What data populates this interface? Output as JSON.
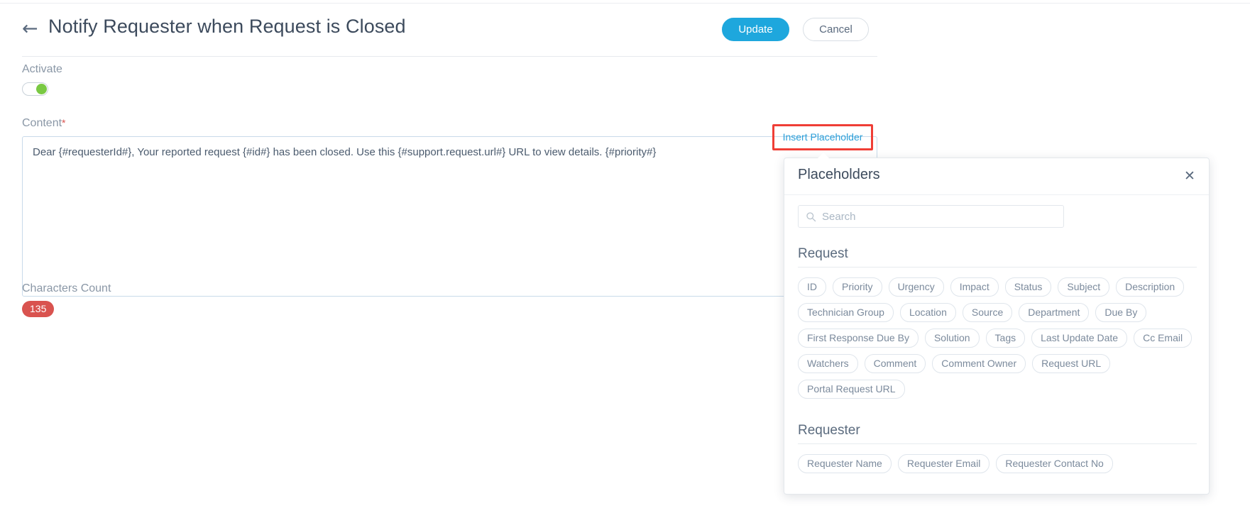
{
  "header": {
    "back_icon": "arrow-left-icon",
    "title": "Notify Requester when Request is Closed",
    "update_label": "Update",
    "cancel_label": "Cancel",
    "accent_color": "#1ea7dd"
  },
  "activate": {
    "label": "Activate",
    "state": "on",
    "knob_color": "#7ac943"
  },
  "content": {
    "label": "Content",
    "required_marker": "*",
    "required_color": "#d9534f",
    "value": "Dear {#requesterId#}, Your reported request {#id#} has been closed. Use this {#support.request.url#} URL to view details. {#priority#}"
  },
  "insert_placeholder": {
    "label": "Insert Placeholder",
    "link_color": "#2b9fd9",
    "highlight_color": "#ef3e36"
  },
  "characters_count": {
    "label": "Characters Count",
    "value": "135",
    "badge_color": "#d9534f"
  },
  "placeholders_panel": {
    "title": "Placeholders",
    "close_icon": "close-icon",
    "search": {
      "placeholder": "Search",
      "value": "",
      "icon": "search-icon"
    },
    "sections": [
      {
        "title": "Request",
        "tags": [
          "ID",
          "Priority",
          "Urgency",
          "Impact",
          "Status",
          "Subject",
          "Description",
          "Technician Group",
          "Location",
          "Source",
          "Department",
          "Due By",
          "First Response Due By",
          "Solution",
          "Tags",
          "Last Update Date",
          "Cc Email",
          "Watchers",
          "Comment",
          "Comment Owner",
          "Request URL",
          "Portal Request URL"
        ]
      },
      {
        "title": "Requester",
        "tags": [
          "Requester Name",
          "Requester Email",
          "Requester Contact No"
        ]
      }
    ]
  }
}
